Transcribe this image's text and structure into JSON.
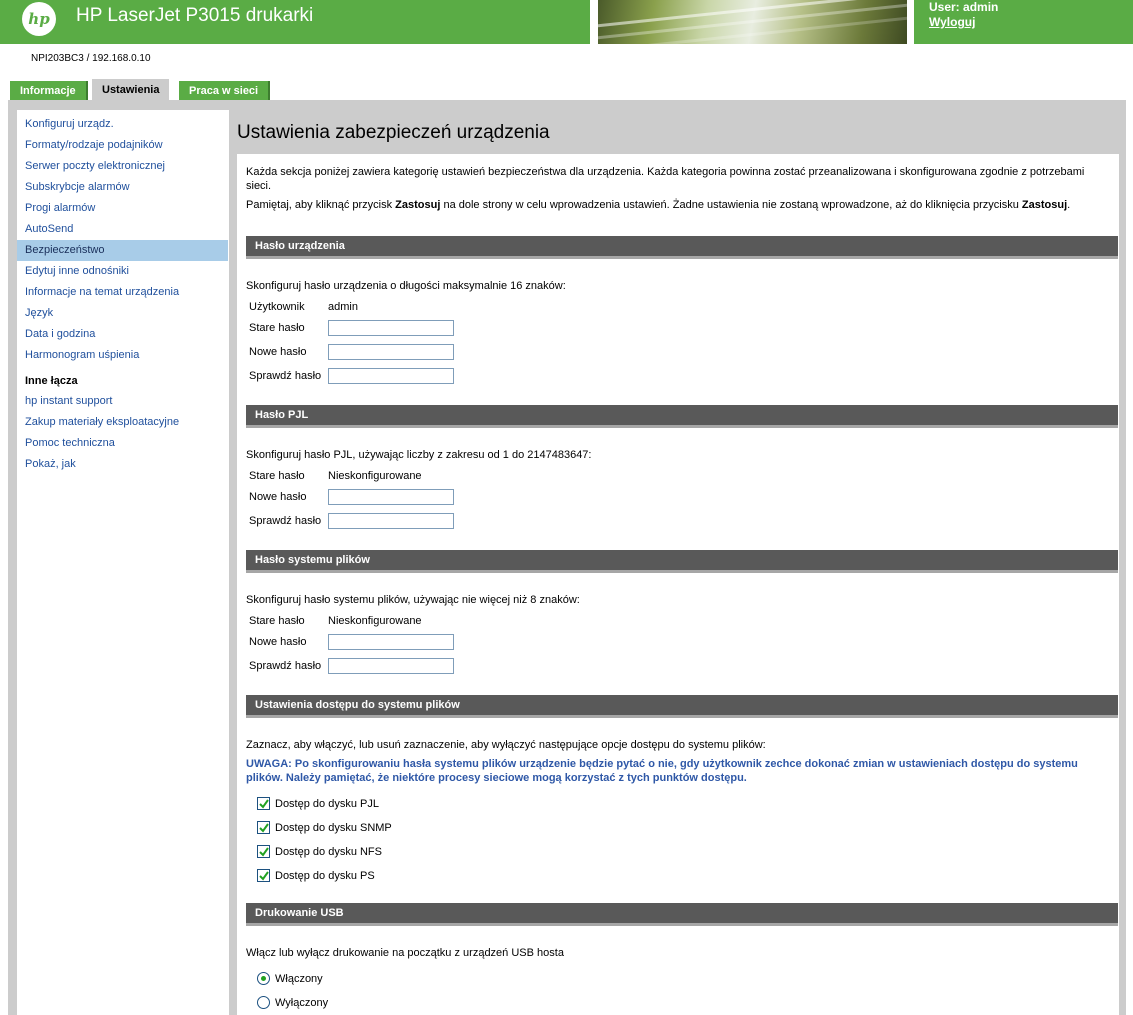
{
  "header": {
    "logo_text": "hp",
    "title": "HP LaserJet P3015 drukarki",
    "user_label": "User: admin",
    "logout_label": "Wyloguj"
  },
  "device_id": "NPI203BC3 / 192.168.0.10",
  "tabs": [
    {
      "label": "Informacje",
      "active": false
    },
    {
      "label": "Ustawienia",
      "active": true
    },
    {
      "label": "Praca w sieci",
      "active": false
    }
  ],
  "sidebar": {
    "items": [
      {
        "label": "Konfiguruj urządz.",
        "selected": false
      },
      {
        "label": "Formaty/rodzaje podajników",
        "selected": false
      },
      {
        "label": "Serwer poczty elektronicznej",
        "selected": false
      },
      {
        "label": "Subskrybcje alarmów",
        "selected": false
      },
      {
        "label": "Progi alarmów",
        "selected": false
      },
      {
        "label": "AutoSend",
        "selected": false
      },
      {
        "label": "Bezpieczeństwo",
        "selected": true
      },
      {
        "label": "Edytuj inne odnośniki",
        "selected": false
      },
      {
        "label": "Informacje na temat urządzenia",
        "selected": false
      },
      {
        "label": "Język",
        "selected": false
      },
      {
        "label": "Data i godzina",
        "selected": false
      },
      {
        "label": "Harmonogram uśpienia",
        "selected": false
      }
    ],
    "links_heading": "Inne łącza",
    "links": [
      {
        "label": "hp instant support"
      },
      {
        "label": "Zakup materiały eksploatacyjne"
      },
      {
        "label": "Pomoc techniczna"
      },
      {
        "label": "Pokaż, jak"
      }
    ]
  },
  "main": {
    "title": "Ustawienia zabezpieczeń urządzenia",
    "intro_1": "Każda sekcja poniżej zawiera kategorię ustawień bezpieczeństwa dla urządzenia. Każda kategoria powinna zostać przeanalizowana i skonfigurowana zgodnie z potrzebami sieci.",
    "intro_2_pre": "Pamiętaj, aby kliknąć przycisk ",
    "intro_2_b1": "Zastosuj",
    "intro_2_mid": " na dole strony w celu wprowadzenia ustawień. Żadne ustawienia nie zostaną wprowadzone, aż do kliknięcia przycisku ",
    "intro_2_b2": "Zastosuj",
    "intro_2_post": ".",
    "device_password": {
      "header": "Hasło urządzenia",
      "description": "Skonfiguruj hasło urządzenia o długości maksymalnie 16 znaków:",
      "user_label": "Użytkownik",
      "user_value": "admin",
      "old_label": "Stare hasło",
      "new_label": "Nowe hasło",
      "verify_label": "Sprawdź hasło"
    },
    "pjl_password": {
      "header": "Hasło PJL",
      "description": "Skonfiguruj hasło PJL, używając liczby z zakresu od 1 do 2147483647:",
      "old_label": "Stare hasło",
      "old_value": "Nieskonfigurowane",
      "new_label": "Nowe hasło",
      "verify_label": "Sprawdź hasło"
    },
    "fs_password": {
      "header": "Hasło systemu plików",
      "description": "Skonfiguruj hasło systemu plików, używając nie więcej niż 8 znaków:",
      "old_label": "Stare hasło",
      "old_value": "Nieskonfigurowane",
      "new_label": "Nowe hasło",
      "verify_label": "Sprawdź hasło"
    },
    "fs_access": {
      "header": "Ustawienia dostępu do systemu plików",
      "description": "Zaznacz, aby włączyć, lub usuń zaznaczenie, aby wyłączyć następujące opcje dostępu do systemu plików:",
      "note": "UWAGA: Po skonfigurowaniu hasła systemu plików urządzenie będzie pytać o nie, gdy użytkownik zechce dokonać zmian w ustawieniach dostępu do systemu plików. Należy pamiętać, że niektóre procesy sieciowe mogą korzystać z tych punktów dostępu.",
      "options": [
        {
          "label": "Dostęp do dysku PJL",
          "checked": true
        },
        {
          "label": "Dostęp do dysku SNMP",
          "checked": true
        },
        {
          "label": "Dostęp do dysku NFS",
          "checked": true
        },
        {
          "label": "Dostęp do dysku PS",
          "checked": true
        }
      ]
    },
    "usb_printing": {
      "header": "Drukowanie USB",
      "description": "Włącz lub wyłącz drukowanie na początku z urządzeń USB hosta",
      "options": [
        {
          "label": "Włączony",
          "selected": true
        },
        {
          "label": "Wyłączony",
          "selected": false
        }
      ]
    }
  },
  "colors": {
    "brand_green": "#5aac45",
    "nav_link": "#1f4f9c",
    "nav_selected_bg": "#a8cce8",
    "section_bar": "#595959",
    "note_blue": "#2f58a7",
    "frame_gray": "#cccccc"
  }
}
